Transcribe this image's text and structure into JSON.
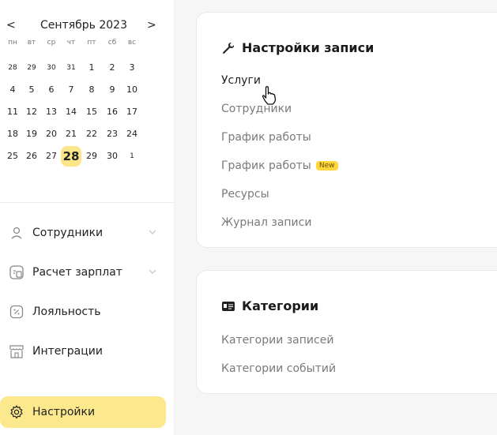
{
  "calendar": {
    "prev_icon": "chevron-left-icon",
    "next_icon": "chevron-right-icon",
    "prev_label": "<",
    "next_label": ">",
    "month_label": "Сентябрь 2023",
    "weekdays": [
      "пн",
      "вт",
      "ср",
      "чт",
      "пт",
      "сб",
      "вс"
    ],
    "weeks": [
      [
        "28",
        "29",
        "30",
        "31",
        "1",
        "2",
        "3"
      ],
      [
        "4",
        "5",
        "6",
        "7",
        "8",
        "9",
        "10"
      ],
      [
        "11",
        "12",
        "13",
        "14",
        "15",
        "16",
        "17"
      ],
      [
        "18",
        "19",
        "20",
        "21",
        "22",
        "23",
        "24"
      ],
      [
        "25",
        "26",
        "27",
        "28",
        "29",
        "30",
        "1"
      ]
    ],
    "today": "28",
    "highlight_color": "#fde58a"
  },
  "sidebar": {
    "items": [
      {
        "label": "Сотрудники",
        "icon": "user-icon",
        "has_chevron": true
      },
      {
        "label": "Расчет зарплат",
        "icon": "payroll-icon",
        "has_chevron": true
      },
      {
        "label": "Лояльность",
        "icon": "percent-icon",
        "has_chevron": false
      },
      {
        "label": "Интеграции",
        "icon": "storefront-icon",
        "has_chevron": false
      },
      {
        "label": "Настройки",
        "icon": "gear-icon",
        "has_chevron": false,
        "active": true
      }
    ],
    "active_color": "#fde98d"
  },
  "records_card": {
    "title": "Настройки записи",
    "title_icon": "wrench-icon",
    "links": [
      {
        "label": "Услуги"
      },
      {
        "label": "Сотрудники"
      },
      {
        "label": "График работы"
      },
      {
        "label": "График работы",
        "badge": "New"
      },
      {
        "label": "Ресурсы"
      },
      {
        "label": "Журнал записи"
      }
    ]
  },
  "categories_card": {
    "title": "Категории",
    "title_icon": "id-card-icon",
    "links": [
      {
        "label": "Категории записей"
      },
      {
        "label": "Категории событий"
      }
    ]
  },
  "cursor": "hand-pointer-icon",
  "colors": {
    "accent": "#fde98d",
    "badge": "#ffd73d"
  }
}
